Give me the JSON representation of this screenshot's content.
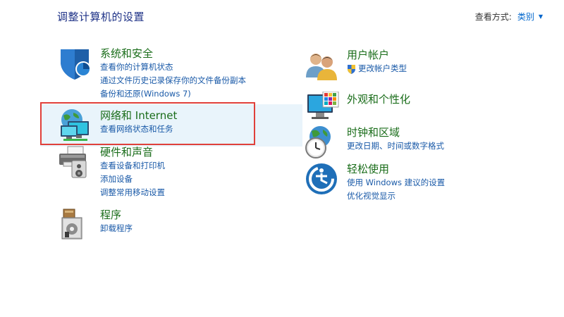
{
  "header": {
    "title": "调整计算机的设置",
    "view_by_label": "查看方式:",
    "view_by_value": "类别"
  },
  "categories_left": [
    {
      "heading": "系统和安全",
      "links": [
        "查看你的计算机状态",
        "通过文件历史记录保存你的文件备份副本",
        "备份和还原(Windows 7)"
      ],
      "icon": "shield-icon"
    },
    {
      "heading": "网络和 Internet",
      "links": [
        "查看网络状态和任务"
      ],
      "icon": "network-globe-icon"
    },
    {
      "heading": "硬件和声音",
      "links": [
        "查看设备和打印机",
        "添加设备",
        "调整常用移动设置"
      ],
      "icon": "printer-speaker-icon"
    },
    {
      "heading": "程序",
      "links": [
        "卸载程序"
      ],
      "icon": "programs-box-icon"
    }
  ],
  "categories_right": [
    {
      "heading": "用户帐户",
      "links": [
        "更改帐户类型"
      ],
      "icon": "users-icon"
    },
    {
      "heading": "外观和个性化",
      "links": [],
      "icon": "monitor-palette-icon"
    },
    {
      "heading": "时钟和区域",
      "links": [
        "更改日期、时间或数字格式"
      ],
      "icon": "globe-clock-icon"
    },
    {
      "heading": "轻松使用",
      "links": [
        "使用 Windows 建议的设置",
        "优化视觉显示"
      ],
      "icon": "ease-of-access-icon"
    }
  ],
  "colors": {
    "heading": "#1a6d1a",
    "link": "#1a5aa8",
    "title": "#1e3287",
    "highlight_border": "#e0403a",
    "hover_bg": "#e9f4fb"
  }
}
